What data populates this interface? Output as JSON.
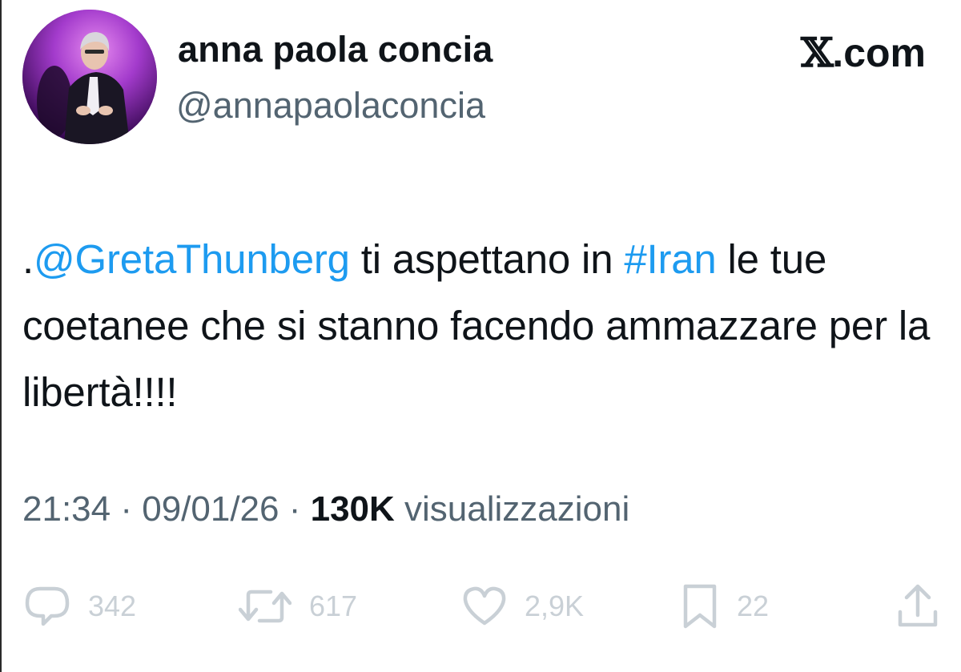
{
  "author": {
    "display_name": "anna paola concia",
    "handle": "@annapaolaconcia"
  },
  "brand": {
    "mark": "𝕏",
    "suffix": ".com"
  },
  "tweet": {
    "prefix": ".",
    "mention": "@GretaThunberg",
    "text_1": " ti aspettano in ",
    "hashtag": "#Iran",
    "text_2": " le tue coetanee che si stanno facendo ammazzare per la libertà!!!!"
  },
  "meta": {
    "time": "21:34",
    "separator": " · ",
    "date": "09/01/26",
    "views_count": "130K",
    "views_label": " visualizzazioni"
  },
  "actions": {
    "reply_count": "342",
    "retweet_count": "617",
    "like_count": "2,9K",
    "bookmark_count": "22"
  },
  "colors": {
    "text": "#0f1419",
    "secondary": "#536471",
    "link": "#1d9bf0",
    "icons": "#c9d0d6"
  }
}
